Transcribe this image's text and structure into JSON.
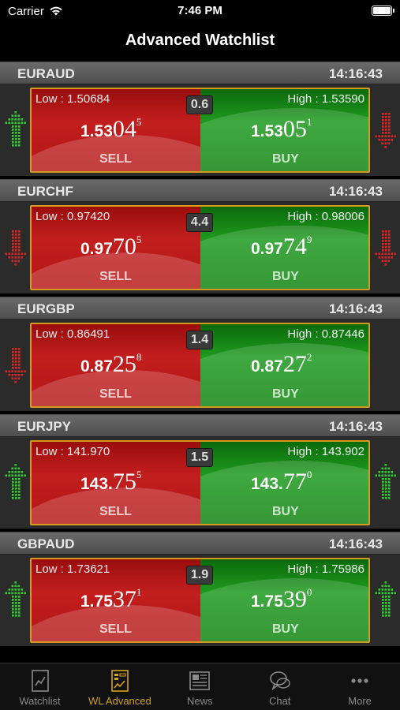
{
  "status_bar": {
    "carrier": "Carrier",
    "time": "7:46 PM"
  },
  "nav": {
    "title": "Advanced Watchlist"
  },
  "pairs": [
    {
      "name": "EURAUD",
      "time": "14:16:43",
      "low": "Low : 1.50684",
      "high": "High : 1.53590",
      "spread": "0.6",
      "sell_big": "1.53",
      "sell_pip": "04",
      "sell_frac": "5",
      "buy_big": "1.53",
      "buy_pip": "05",
      "buy_frac": "1",
      "sell_label": "SELL",
      "buy_label": "BUY",
      "trend_left": "up",
      "trend_right": "down"
    },
    {
      "name": "EURCHF",
      "time": "14:16:43",
      "low": "Low : 0.97420",
      "high": "High : 0.98006",
      "spread": "4.4",
      "sell_big": "0.97",
      "sell_pip": "70",
      "sell_frac": "5",
      "buy_big": "0.97",
      "buy_pip": "74",
      "buy_frac": "9",
      "sell_label": "SELL",
      "buy_label": "BUY",
      "trend_left": "down",
      "trend_right": "down"
    },
    {
      "name": "EURGBP",
      "time": "14:16:43",
      "low": "Low : 0.86491",
      "high": "High : 0.87446",
      "spread": "1.4",
      "sell_big": "0.87",
      "sell_pip": "25",
      "sell_frac": "8",
      "buy_big": "0.87",
      "buy_pip": "27",
      "buy_frac": "2",
      "sell_label": "SELL",
      "buy_label": "BUY",
      "trend_left": "down",
      "trend_right": "none"
    },
    {
      "name": "EURJPY",
      "time": "14:16:43",
      "low": "Low : 141.970",
      "high": "High : 143.902",
      "spread": "1.5",
      "sell_big": "143.",
      "sell_pip": "75",
      "sell_frac": "5",
      "buy_big": "143.",
      "buy_pip": "77",
      "buy_frac": "0",
      "sell_label": "SELL",
      "buy_label": "BUY",
      "trend_left": "up",
      "trend_right": "up"
    },
    {
      "name": "GBPAUD",
      "time": "14:16:43",
      "low": "Low : 1.73621",
      "high": "High : 1.75986",
      "spread": "1.9",
      "sell_big": "1.75",
      "sell_pip": "37",
      "sell_frac": "1",
      "buy_big": "1.75",
      "buy_pip": "39",
      "buy_frac": "0",
      "sell_label": "SELL",
      "buy_label": "BUY",
      "trend_left": "up",
      "trend_right": "up"
    }
  ],
  "tabs": [
    {
      "label": "Watchlist",
      "icon": "watchlist-icon",
      "active": false
    },
    {
      "label": "WL Advanced",
      "icon": "wl-advanced-icon",
      "active": true
    },
    {
      "label": "News",
      "icon": "news-icon",
      "active": false
    },
    {
      "label": "Chat",
      "icon": "chat-icon",
      "active": false
    },
    {
      "label": "More",
      "icon": "more-icon",
      "active": false
    }
  ],
  "colors": {
    "accent": "#d3a319",
    "sell": "#c21e1e",
    "buy": "#1f9a1f",
    "up_arrow": "#2bd12b",
    "down_arrow": "#e02424"
  }
}
